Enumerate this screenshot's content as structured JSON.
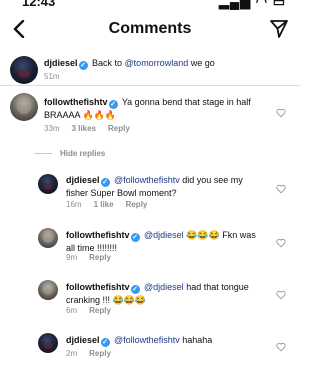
{
  "status_bar": {
    "time": "12:43",
    "icons": "signal-wifi-battery"
  },
  "header": {
    "title": "Comments",
    "back_icon": "chevron-left-icon",
    "send_icon": "send-icon"
  },
  "caption": {
    "username": "djdiesel",
    "verified": true,
    "text_before": "Back to ",
    "mention": "@tomorrowland",
    "text_after": " we go",
    "time": "51m"
  },
  "comments": [
    {
      "username": "followthefishtv",
      "verified": true,
      "text": "Ya gonna bend that stage in half BRAAAA 🔥🔥🔥",
      "time": "33m",
      "likes": "3 likes",
      "reply": "Reply"
    }
  ],
  "hide_replies_label": "Hide replies",
  "replies": [
    {
      "username": "djdiesel",
      "verified": true,
      "mention": "@followthefishtv",
      "text": "did you see my fisher Super Bowl moment?",
      "time": "16m",
      "likes": "1 like",
      "reply": "Reply"
    },
    {
      "username": "followthefishtv",
      "verified": true,
      "mention": "@djdiesel",
      "text": "😂😂😂 Fkn was all time !!!!!!!!",
      "time": "9m",
      "likes": "",
      "reply": "Reply"
    },
    {
      "username": "followthefishtv",
      "verified": true,
      "mention": "@djdiesel",
      "text": "had that tongue cranking !!! 😂😂😂",
      "time": "6m",
      "likes": "",
      "reply": "Reply"
    },
    {
      "username": "djdiesel",
      "verified": true,
      "mention": "@followthefishtv",
      "text": "hahaha",
      "time": "2m",
      "likes": "",
      "reply": "Reply"
    }
  ],
  "colors": {
    "verified": "#3897f0",
    "mention": "#1b3a8a",
    "meta": "#8e8e8e"
  }
}
